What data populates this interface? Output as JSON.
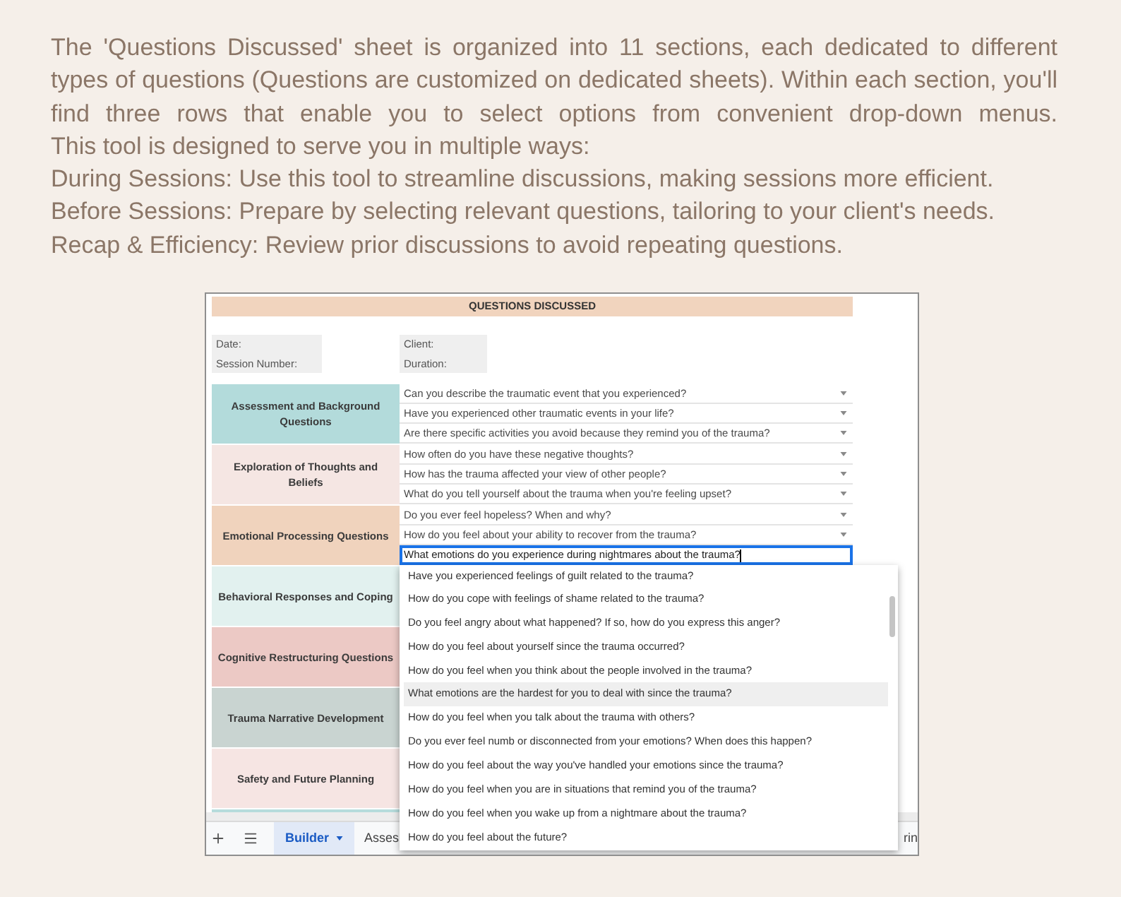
{
  "intro": {
    "paragraph": "The 'Questions Discussed' sheet is organized into 11 sections, each dedicated to different types of questions (Questions are customized on dedicated sheets). Within each section, you'll find three rows that enable you to select options from convenient drop-down menus.",
    "lead": "This tool is designed to serve you in multiple ways:",
    "uses": [
      "During Sessions: Use this tool to streamline discussions, making sessions more efficient.",
      "Before Sessions: Prepare by selecting relevant questions, tailoring to your client's needs.",
      "Recap & Efficiency: Review prior discussions to avoid repeating questions."
    ]
  },
  "sheet": {
    "title": "QUESTIONS DISCUSSED",
    "info_rows": [
      {
        "left": "Date:",
        "right": "Client:"
      },
      {
        "left": "Session Number:",
        "right": "Duration:"
      }
    ],
    "sections": [
      {
        "label": "Assessment and Background Questions",
        "color": "#b3dbdb",
        "questions": [
          {
            "text": "Can you describe the traumatic event that you experienced?",
            "active": false
          },
          {
            "text": "Have you experienced other traumatic events in your life?",
            "active": false
          },
          {
            "text": "Are there specific activities you avoid because they remind you of the trauma?",
            "active": false
          }
        ]
      },
      {
        "label": "Exploration of Thoughts and Beliefs",
        "color": "#f5e6e3",
        "questions": [
          {
            "text": "How often do you have these negative thoughts?",
            "active": false
          },
          {
            "text": "How has the trauma affected your view of other people?",
            "active": false
          },
          {
            "text": "What do you tell yourself about the trauma when you're feeling upset?",
            "active": false
          }
        ]
      },
      {
        "label": "Emotional Processing Questions",
        "color": "#f0d3bd",
        "questions": [
          {
            "text": "Do you ever feel hopeless? When and why?",
            "active": false
          },
          {
            "text": "How do you feel about your ability to recover from the trauma?",
            "active": false
          },
          {
            "text": "What emotions do you experience during nightmares about the trauma?",
            "active": true
          }
        ]
      },
      {
        "label": "Behavioral Responses and Coping",
        "color": "#e2f1ef"
      },
      {
        "label": "Cognitive Restructuring Questions",
        "color": "#ecc9c5"
      },
      {
        "label": "Trauma Narrative Development",
        "color": "#c9d4d1"
      },
      {
        "label": "Safety and Future Planning",
        "color": "#f6e5e3"
      },
      {
        "color": "#b6dcdc"
      }
    ],
    "dropdown": {
      "options": [
        {
          "text": "Have you experienced feelings of guilt related to the trauma?",
          "highlighted": false
        },
        {
          "text": "How do you cope with feelings of shame related to the trauma?",
          "highlighted": false
        },
        {
          "text": "Do you feel angry about what happened? If so, how do you express this anger?",
          "highlighted": false
        },
        {
          "text": "How do you feel about yourself since the trauma occurred?",
          "highlighted": false
        },
        {
          "text": "How do you feel when you think about the people involved in the trauma?",
          "highlighted": false
        },
        {
          "text": "What emotions are the hardest for you to deal with since the trauma?",
          "highlighted": true
        },
        {
          "text": "How do you feel when you talk about the trauma with others?",
          "highlighted": false
        },
        {
          "text": "Do you ever feel numb or disconnected from your emotions? When does this happen?",
          "highlighted": false
        },
        {
          "text": "How do you feel about the way you've handled your emotions since the trauma?",
          "highlighted": false
        },
        {
          "text": "How do you feel when you are in situations that remind you of the trauma?",
          "highlighted": false
        },
        {
          "text": "How do you feel when you wake up from a nightmare about the trauma?",
          "highlighted": false
        },
        {
          "text": "How do you feel about the future?",
          "highlighted": false
        }
      ]
    },
    "tabs": [
      {
        "label": "Builder",
        "selected": true
      },
      {
        "label": "Asses",
        "selected": false
      },
      {
        "label": "rin",
        "selected": false
      }
    ]
  }
}
